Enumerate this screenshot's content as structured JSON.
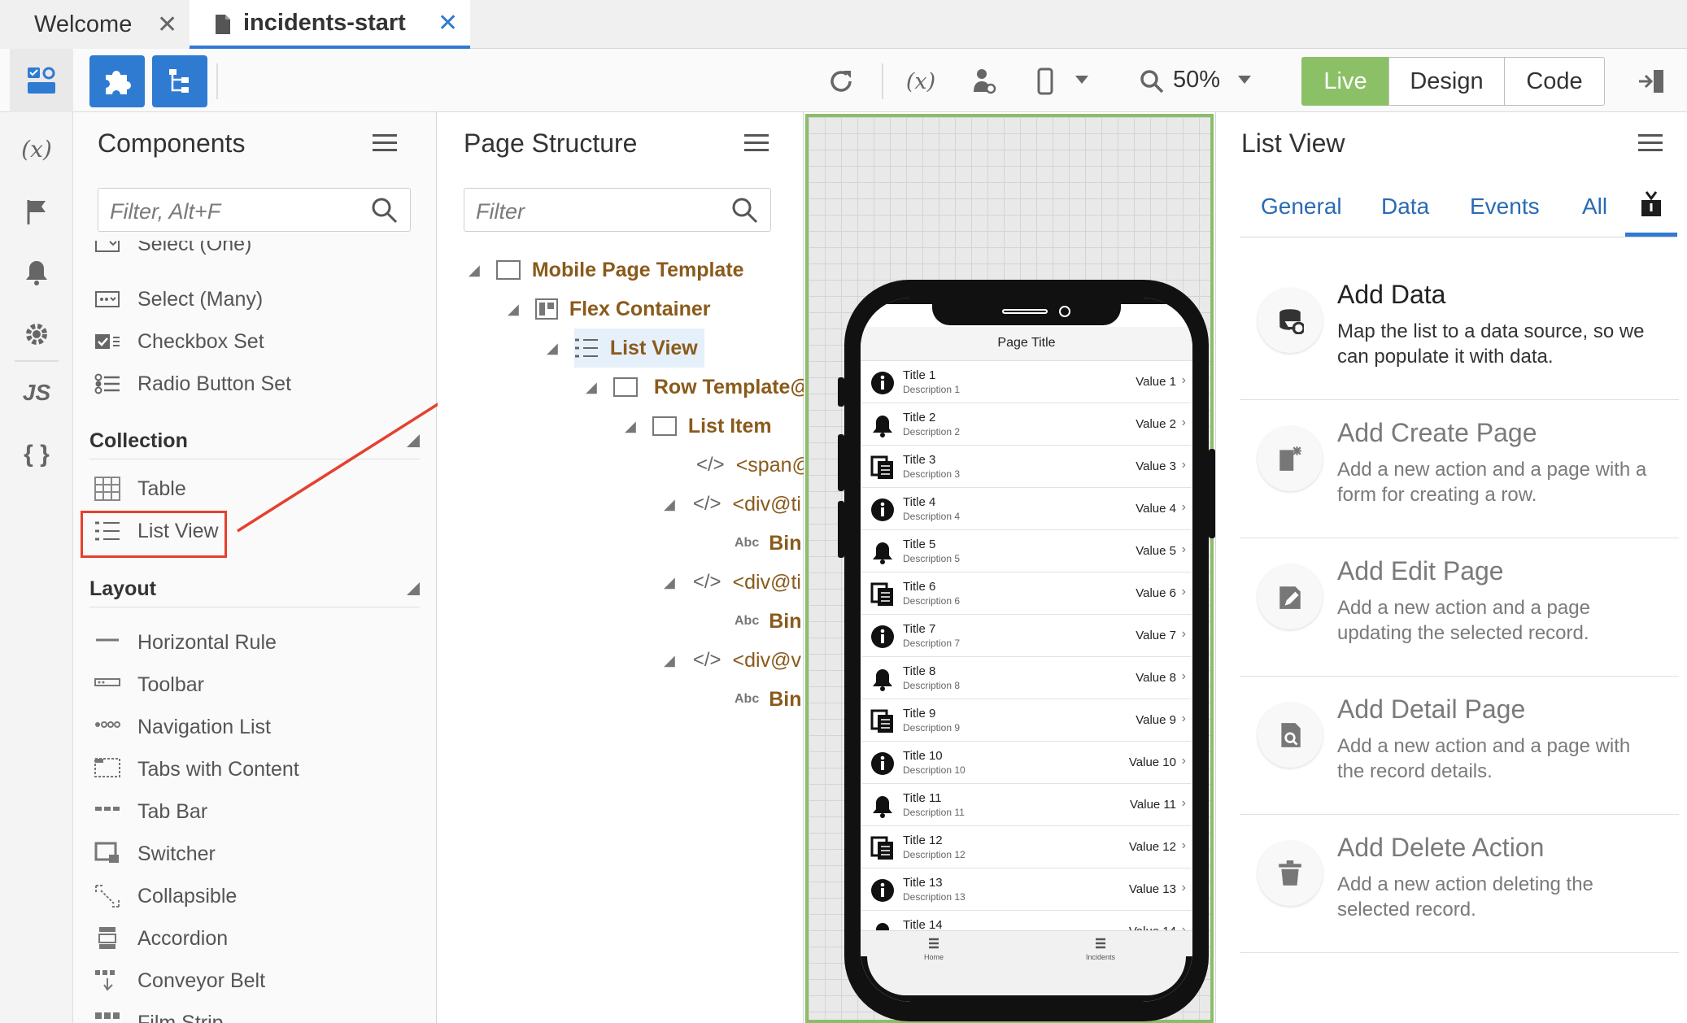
{
  "tabs": [
    {
      "label": "Welcome",
      "close": "✕"
    },
    {
      "label": "incidents-start",
      "close": "✕"
    }
  ],
  "toolbar": {
    "zoom": "50%",
    "modes": [
      "Live",
      "Design",
      "Code"
    ],
    "active_mode": "Live"
  },
  "rail": {
    "variables_icon": "(x)",
    "js_label": "JS",
    "braces_label": "{ }"
  },
  "components": {
    "title": "Components",
    "filter_placeholder": "Filter, Alt+F",
    "items_top": [
      "Select (One)",
      "Select (Many)",
      "Checkbox Set",
      "Radio Button Set"
    ],
    "collection_header": "Collection",
    "collection_items": [
      "Table",
      "List View"
    ],
    "layout_header": "Layout",
    "layout_items": [
      "Horizontal Rule",
      "Toolbar",
      "Navigation List",
      "Tabs with Content",
      "Tab Bar",
      "Switcher",
      "Collapsible",
      "Accordion",
      "Conveyor Belt",
      "Film Strip"
    ]
  },
  "structure": {
    "title": "Page Structure",
    "filter_placeholder": "Filter",
    "nodes": [
      "Mobile Page Template",
      "Flex Container",
      "List View",
      "Row Template@",
      "List Item",
      "<span@",
      "<div@ti",
      "Bin",
      "<div@ti",
      "Bin",
      "<div@v",
      "Bin"
    ],
    "code_icon": "</>",
    "abc_icon": "Abc"
  },
  "phone": {
    "page_title": "Page Title",
    "rows": [
      {
        "title": "Title 1",
        "desc": "Description 1",
        "value": "Value 1",
        "icon": "info-icon"
      },
      {
        "title": "Title 2",
        "desc": "Description 2",
        "value": "Value 2",
        "icon": "bell-icon"
      },
      {
        "title": "Title 3",
        "desc": "Description 3",
        "value": "Value 3",
        "icon": "pages-icon"
      },
      {
        "title": "Title 4",
        "desc": "Description 4",
        "value": "Value 4",
        "icon": "info-icon"
      },
      {
        "title": "Title 5",
        "desc": "Description 5",
        "value": "Value 5",
        "icon": "bell-icon"
      },
      {
        "title": "Title 6",
        "desc": "Description 6",
        "value": "Value 6",
        "icon": "pages-icon"
      },
      {
        "title": "Title 7",
        "desc": "Description 7",
        "value": "Value 7",
        "icon": "info-icon"
      },
      {
        "title": "Title 8",
        "desc": "Description 8",
        "value": "Value 8",
        "icon": "bell-icon"
      },
      {
        "title": "Title 9",
        "desc": "Description 9",
        "value": "Value 9",
        "icon": "pages-icon"
      },
      {
        "title": "Title 10",
        "desc": "Description 10",
        "value": "Value 10",
        "icon": "info-icon"
      },
      {
        "title": "Title 11",
        "desc": "Description 11",
        "value": "Value 11",
        "icon": "bell-icon"
      },
      {
        "title": "Title 12",
        "desc": "Description 12",
        "value": "Value 12",
        "icon": "pages-icon"
      },
      {
        "title": "Title 13",
        "desc": "Description 13",
        "value": "Value 13",
        "icon": "info-icon"
      },
      {
        "title": "Title 14",
        "desc": "",
        "value": "Value 14",
        "icon": "bell-icon"
      }
    ],
    "nav": [
      "Home",
      "Incidents"
    ]
  },
  "properties": {
    "title": "List View",
    "tabs": [
      "General",
      "Data",
      "Events",
      "All"
    ],
    "actions": [
      {
        "title": "Add Data",
        "desc": "Map the list to a data source, so we can populate it with data.",
        "icon": "database-icon"
      },
      {
        "title": "Add Create Page",
        "desc": "Add a new action and a page with a form for creating a row.",
        "icon": "new-page-icon"
      },
      {
        "title": "Add Edit Page",
        "desc": "Add a new action and a page updating the selected record.",
        "icon": "edit-page-icon"
      },
      {
        "title": "Add Detail Page",
        "desc": "Add a new action and a page with the record details.",
        "icon": "detail-page-icon"
      },
      {
        "title": "Add Delete Action",
        "desc": "Add a new action deleting the selected record.",
        "icon": "trash-icon"
      }
    ]
  },
  "colors": {
    "accent": "#2f7bd1",
    "live": "#8cc066",
    "node_brown": "#8a5a1b",
    "annotation_red": "#e4412f"
  }
}
